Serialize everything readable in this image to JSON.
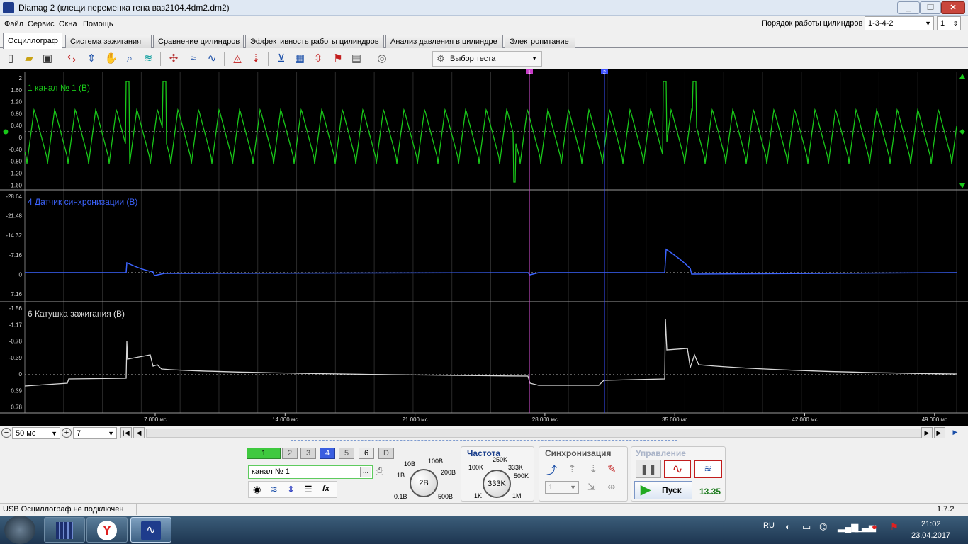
{
  "window": {
    "title": "Diamag 2 (клещи переменка гена ваз2104.4dm2.dm2)",
    "minimize": "_",
    "maximize": "❐",
    "close": "✕"
  },
  "menu": [
    "Файл",
    "Сервис",
    "Окна",
    "Помощь"
  ],
  "cylinder_order": {
    "label": "Порядок работы цилиндров",
    "value": "1-3-4-2",
    "number": "1"
  },
  "tabs": [
    "Осциллограф",
    "Система зажигания",
    "Сравнение цилиндров",
    "Эффективность работы цилиндров",
    "Анализ давления в цилиндре",
    "Электропитание"
  ],
  "test_select": "Выбор теста",
  "toolbar_icons": [
    "new-icon",
    "open-icon",
    "save-icon",
    "channel-zoom-icon",
    "cursor-icon",
    "hand-icon",
    "zoom-icon",
    "filter-icon",
    "sync-icon",
    "overlay-icon",
    "wave-icon",
    "auto-scale-icon",
    "zero-icon",
    "select-icon",
    "table-icon",
    "align-icon",
    "flag-icon",
    "report-icon",
    "auto-icon"
  ],
  "channels": [
    {
      "name": "1 канал № 1 (В)",
      "color": "#19c819",
      "ticks": [
        "2",
        "1.60",
        "1.20",
        "0.80",
        "0.40",
        "0",
        "-0.40",
        "-0.80",
        "-1.20",
        "-1.60"
      ]
    },
    {
      "name": "4 Датчик синхронизации (В)",
      "color": "#3c64ff",
      "ticks": [
        "-28.64",
        "-21.48",
        "-14.32",
        "-7.16",
        "0",
        "7.16"
      ]
    },
    {
      "name": "6 Катушка зажигания (В)",
      "color": "#d8d8d8",
      "ticks": [
        "-1.56",
        "-1.17",
        "-0.78",
        "-0.39",
        "0",
        "0.39",
        "0.78"
      ]
    }
  ],
  "time_axis": [
    "7.000 мс",
    "14.000 мс",
    "21.000 мс",
    "28.000 мс",
    "35.000 мс",
    "42.000 мс",
    "49.000 мс"
  ],
  "markers": {
    "m1": "1",
    "m2": "2"
  },
  "timebase": {
    "value": "50 мс",
    "zoom": "7"
  },
  "channel_buttons": [
    "1",
    "2",
    "3",
    "4",
    "5",
    "6",
    "D"
  ],
  "channel_name": "канал № 1",
  "channel_browse": "...",
  "function_label": "fx",
  "scale": {
    "labels": [
      "10В",
      "100В",
      "1В",
      "200В",
      "0.1В",
      "500В"
    ],
    "value": "2В"
  },
  "freq": {
    "title": "Частота",
    "labels": [
      "250K",
      "100K",
      "333K",
      "500K",
      "1K",
      "1M"
    ],
    "value": "333K"
  },
  "sync": {
    "title": "Синхронизация",
    "value": "1"
  },
  "control": {
    "title": "Управление",
    "start": "Пуск",
    "value": "13.35"
  },
  "status": {
    "text": "USB Осциллограф не подключен",
    "version": "1.7.2"
  },
  "taskbar": {
    "lang": "RU",
    "time": "21:02",
    "date": "23.04.2017"
  }
}
